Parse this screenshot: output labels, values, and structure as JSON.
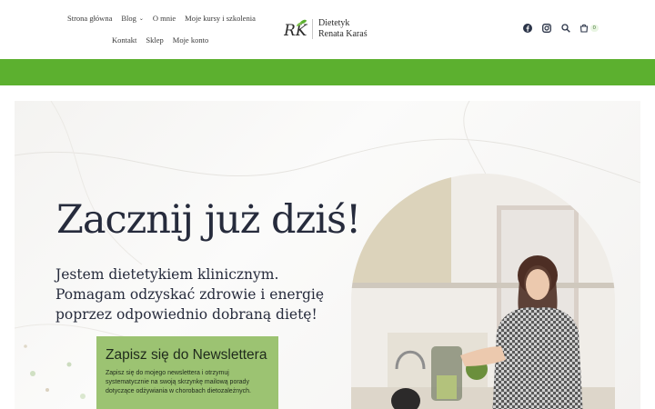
{
  "nav": {
    "row1": [
      {
        "label": "Strona główna"
      },
      {
        "label": "Blog",
        "has_dropdown": true
      },
      {
        "label": "O mnie"
      },
      {
        "label": "Moje kursy i szkolenia"
      }
    ],
    "row2": [
      {
        "label": "Kontakt"
      },
      {
        "label": "Sklep"
      },
      {
        "label": "Moje konto"
      }
    ]
  },
  "logo": {
    "monogram": "RK",
    "line1": "Dietetyk",
    "line2": "Renata Karaś"
  },
  "header_icons": {
    "facebook": "facebook-icon",
    "instagram": "instagram-icon",
    "search": "search-icon",
    "cart": "cart-icon",
    "cart_count": "0"
  },
  "colors": {
    "accent_green": "#5cb02f",
    "newsletter_green": "#9cc372",
    "heading_navy": "#262b3c"
  },
  "hero": {
    "title": "Zacznij już dziś!",
    "subtitle_lines": [
      "Jestem dietetykiem klinicznym.",
      "Pomagam odzyskać zdrowie i energię",
      "poprzez odpowiednio dobraną dietę!"
    ]
  },
  "newsletter": {
    "title": "Zapisz się do Newslettera",
    "text": "Zapisz się do mojego newslettera i otrzymuj systematycznie na swoją skrzynkę mailową porady dotyczące odżywiania w chorobach dietozależnych."
  }
}
